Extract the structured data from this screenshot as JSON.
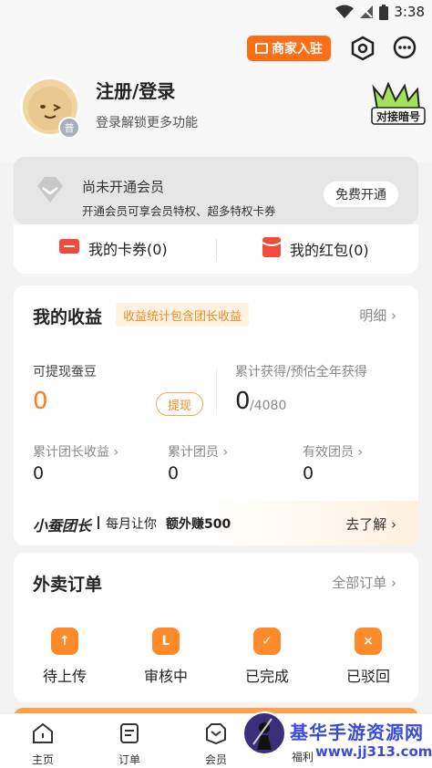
{
  "status": {
    "time": "3:38"
  },
  "header": {
    "merchant_label": "商家入驻",
    "login_title": "注册/登录",
    "login_sub": "登录解锁更多功能",
    "avatar_badge": "普",
    "badge_text": "对接暗号"
  },
  "member": {
    "title": "尚未开通会员",
    "desc": "开通会员可享会员特权、超多特权卡券",
    "button": "免费开通"
  },
  "coupons": {
    "cards": "我的卡券(0)",
    "redpacks": "我的红包(0)"
  },
  "earnings": {
    "title": "我的收益",
    "tag": "收益统计包含团长收益",
    "detail": "明细",
    "withdrawable_label": "可提现蚕豆",
    "withdrawable_value": "0",
    "withdraw_btn": "提现",
    "total_label": "累计获得/预估全年获得",
    "total_value": "0",
    "total_suffix": "/4080",
    "stats": [
      {
        "label": "累计团长收益",
        "value": "0"
      },
      {
        "label": "累计团员",
        "value": "0"
      },
      {
        "label": "有效团员",
        "value": "0"
      }
    ],
    "team_brand": "小蚕团长",
    "team_text": "每月让你",
    "team_bold": "额外赚500",
    "learn_more": "去了解"
  },
  "orders": {
    "title": "外卖订单",
    "all": "全部订单",
    "items": [
      {
        "label": "待上传",
        "icon": "↑"
      },
      {
        "label": "审核中",
        "icon": "L"
      },
      {
        "label": "已完成",
        "icon": "✓"
      },
      {
        "label": "已驳回",
        "icon": "×"
      }
    ]
  },
  "tabs": [
    "主页",
    "订单",
    "会员",
    "福利"
  ],
  "watermark": {
    "line1": "基华手游资源网",
    "line2": "www.jj313.com"
  },
  "colors": {
    "accent": "#ff7a1a",
    "brand": "#ff6e16"
  }
}
